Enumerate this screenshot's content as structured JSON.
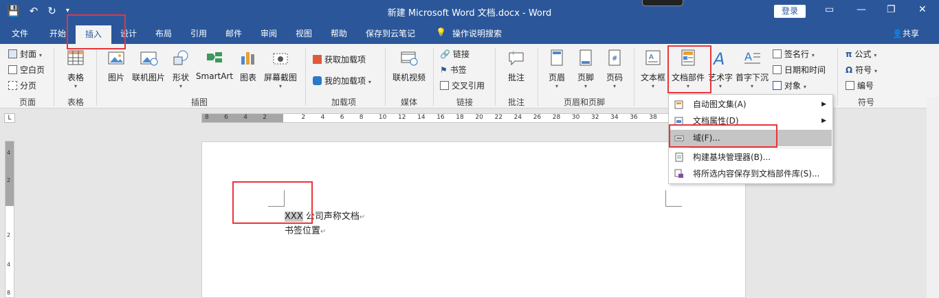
{
  "titlebar": {
    "title": "新建 Microsoft Word 文档.docx  -  Word",
    "login": "登录",
    "qat_save": "💾",
    "qat_undo": "↶",
    "qat_redo": "↻",
    "qat_more": "▾",
    "win_restore_ribbon": "▭",
    "win_min": "—",
    "win_max": "❐",
    "win_close": "✕"
  },
  "tabs": [
    "文件",
    "开始",
    "插入",
    "设计",
    "布局",
    "引用",
    "邮件",
    "审阅",
    "视图",
    "帮助",
    "保存到云笔记"
  ],
  "tell_me": "操作说明搜索",
  "share": "共享",
  "ribbon": {
    "pages": {
      "cover": "封面",
      "blank": "空白页",
      "break": "分页",
      "label": "页面"
    },
    "table": {
      "btn": "表格",
      "label": "表格"
    },
    "illustrations": {
      "picture": "图片",
      "online_picture": "联机图片",
      "shapes": "形状",
      "smartart": "SmartArt",
      "chart": "图表",
      "screenshot": "屏幕截图",
      "label": "插图"
    },
    "addins": {
      "get": "获取加载项",
      "my": "我的加载项",
      "label": "加载项"
    },
    "media": {
      "video": "联机视频",
      "label": "媒体"
    },
    "links": {
      "link": "链接",
      "bookmark": "书签",
      "cross_ref": "交叉引用",
      "label": "链接"
    },
    "comments": {
      "comment": "批注",
      "label": "批注"
    },
    "header_footer": {
      "header": "页眉",
      "footer": "页脚",
      "page_number": "页码",
      "label": "页眉和页脚"
    },
    "text": {
      "textbox": "文本框",
      "quick_parts": "文档部件",
      "wordart": "艺术字",
      "dropcap": "首字下沉",
      "signature": "签名行",
      "datetime": "日期和时间",
      "object": "对象"
    },
    "symbols": {
      "equation": "公式",
      "symbol": "符号",
      "numbering": "编号",
      "label": "符号"
    }
  },
  "ruler": {
    "tab_selector": "L",
    "h_numbers": [
      "8",
      "6",
      "4",
      "2",
      "",
      "2",
      "4",
      "6",
      "8",
      "10",
      "12",
      "14",
      "16",
      "18",
      "20",
      "22",
      "24",
      "26",
      "28",
      "30",
      "32",
      "34",
      "36",
      "38"
    ],
    "v_numbers": [
      "4",
      "2",
      "",
      "2",
      "4",
      "8"
    ]
  },
  "document": {
    "line1_selected": "XXX",
    "line1_rest": " 公司声称文档",
    "line2": "书签位置",
    "para_mark": "↵"
  },
  "dropdown": {
    "items": [
      {
        "label": "自动图文集(A)",
        "has_submenu": true
      },
      {
        "label": "文档属性(D)",
        "has_submenu": true
      },
      {
        "label": "域(F)...",
        "has_submenu": false,
        "highlighted": true
      },
      {
        "label": "构建基块管理器(B)...",
        "has_submenu": false
      },
      {
        "label": "将所选内容保存到文档部件库(S)...",
        "has_submenu": false
      }
    ],
    "submenu_arrow": "▶"
  },
  "colors": {
    "title_blue": "#2b579a",
    "ribbon_bg": "#f3f3f3",
    "annotation_red": "#e8343a",
    "highlight_gray": "#c5c5c5"
  }
}
